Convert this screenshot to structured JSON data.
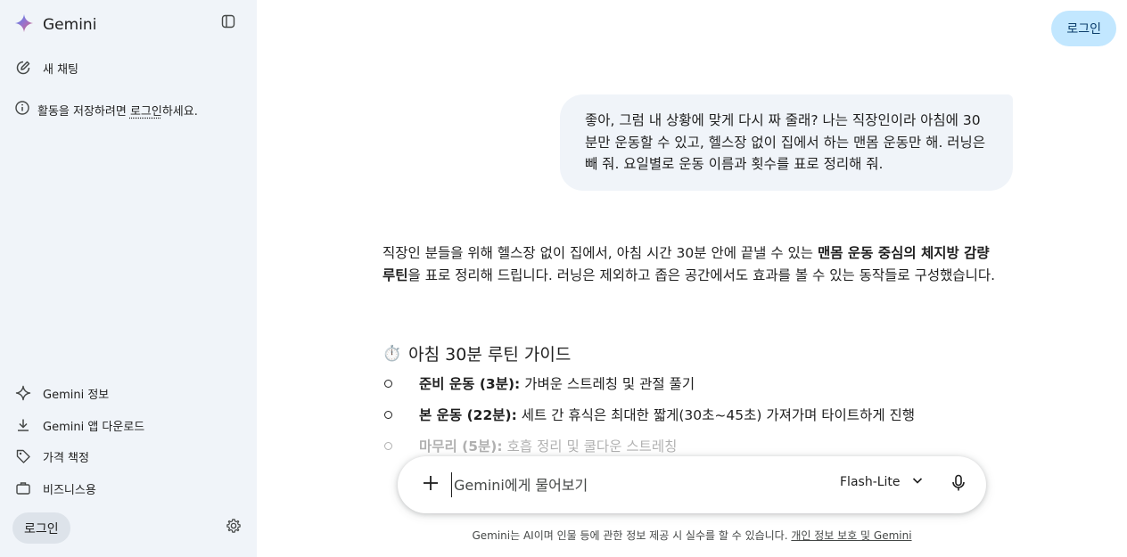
{
  "sidebar": {
    "brand": "Gemini",
    "new_chat": "새 채팅",
    "notice_prefix": "활동을 저장하려면 ",
    "notice_link": "로그인",
    "notice_suffix": "하세요.",
    "items": [
      {
        "label": "Gemini 정보",
        "icon": "sparkle-icon"
      },
      {
        "label": "Gemini 앱 다운로드",
        "icon": "download-icon"
      },
      {
        "label": "가격 책정",
        "icon": "tag-icon"
      },
      {
        "label": "비즈니스용",
        "icon": "briefcase-icon"
      }
    ],
    "login_label": "로그인"
  },
  "header": {
    "login_label": "로그인"
  },
  "conversation": {
    "user_message": "좋아, 그럼 내 상황에 맞게 다시 짜 줄래? 나는 직장인이라 아침에 30분만 운동할 수 있고, 헬스장 없이 집에서 하는 맨몸 운동만 해. 러닝은 빼 줘. 요일별로 운동 이름과 횟수를 표로 정리해 줘.",
    "response_intro_1": "직장인 분들을 위해 헬스장 없이 집에서, 아침 시간 30분 안에 끝낼 수 있는 ",
    "response_intro_bold": "맨몸 운동 중심의 체지방 감량 루틴",
    "response_intro_2": "을 표로 정리해 드립니다. 러닝은 제외하고 좁은 공간에서도 효과를 볼 수 있는 동작들로 구성했습니다.",
    "section_icon": "⏱️",
    "section_title": "아침 30분 루틴 가이드",
    "bullets": [
      {
        "bold": "준비 운동 (3분):",
        "text": "가벼운 스트레칭 및 관절 풀기"
      },
      {
        "bold": "본 운동 (22분):",
        "text": "세트 간 휴식은 최대한 짧게(30초~45초) 가져가며 타이트하게 진행"
      },
      {
        "bold": "마무리 (5분):",
        "text": "호흡 정리 및 쿨다운 스트레칭"
      }
    ]
  },
  "input": {
    "placeholder": "Gemini에게 물어보기",
    "model": "Flash-Lite"
  },
  "footer": {
    "disclaimer": "Gemini는 AI이며 인물 등에 관한 정보 제공 시 실수를 할 수 있습니다. ",
    "disclaimer_link": "개인 정보 보호 및 Gemini"
  },
  "colors": {
    "sidebar_bg": "#f0f4f9",
    "login_button_bg": "#c2e7ff",
    "user_bubble_bg": "#f0f4f9"
  }
}
